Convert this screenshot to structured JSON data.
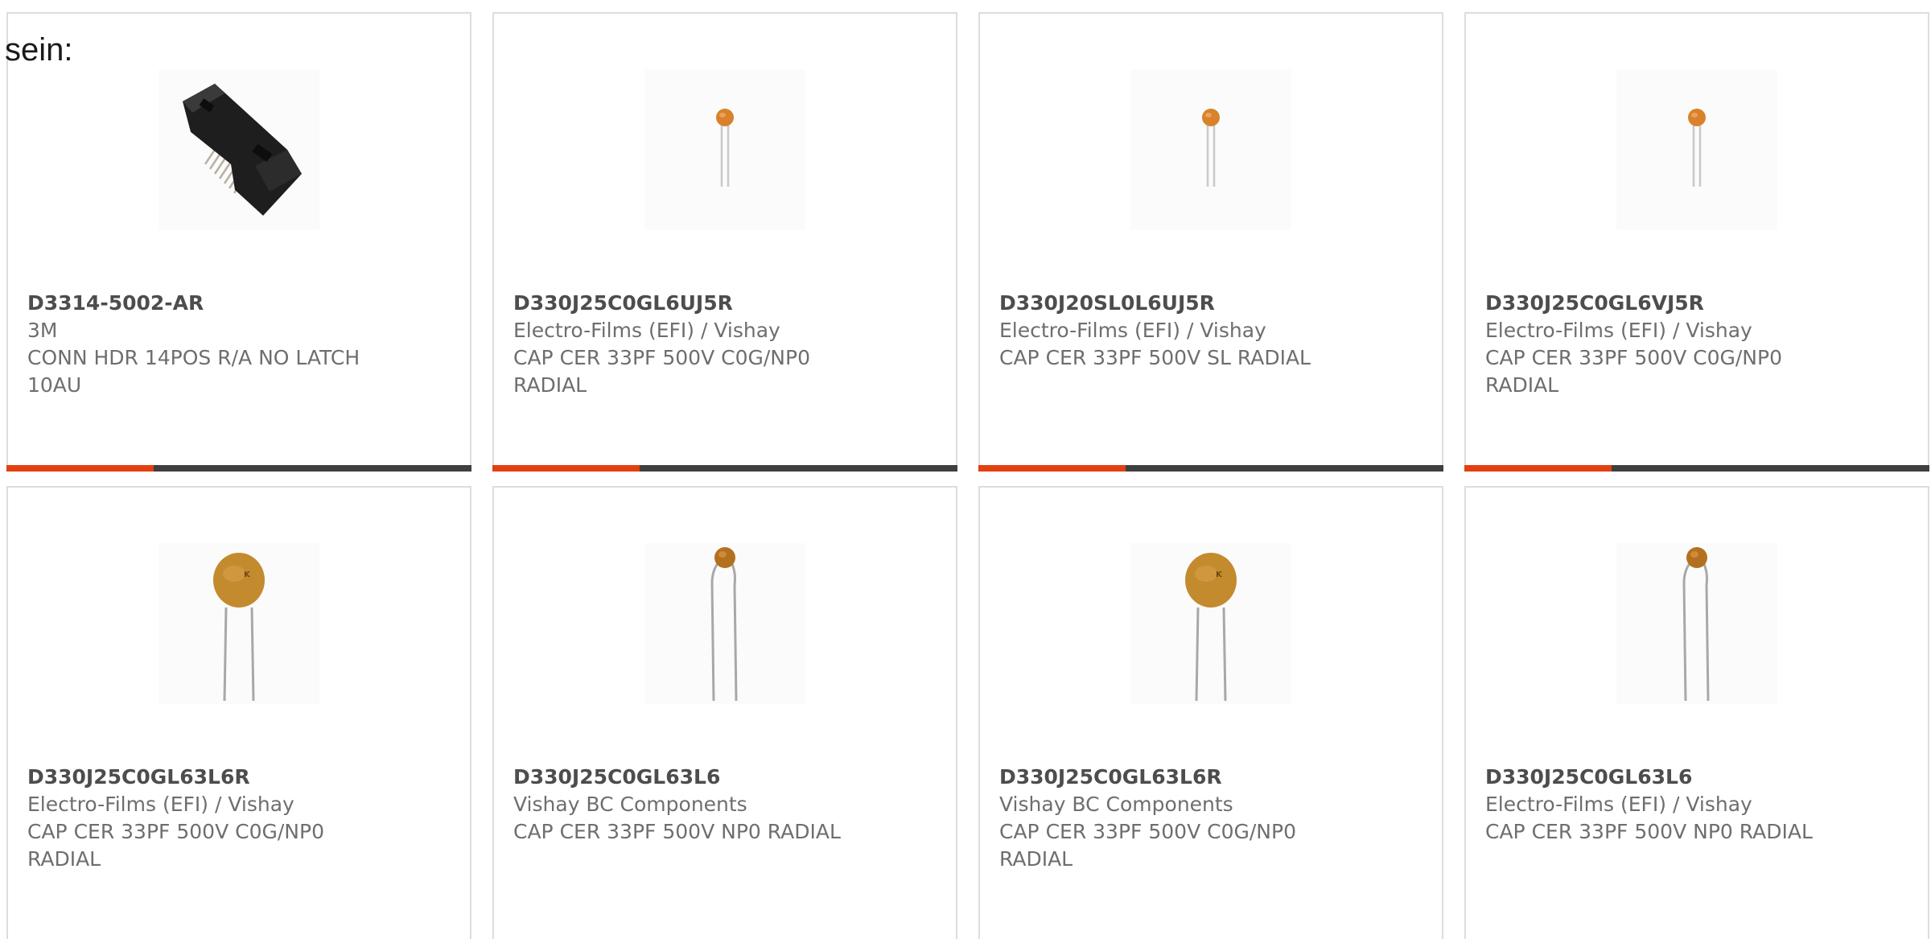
{
  "heading": "sein:",
  "colors": {
    "accent": "#e24011",
    "bar": "#3f3f3f",
    "border": "#dddddd",
    "text": "#6e6e6e"
  },
  "products": [
    {
      "part_number": "D3314-5002-AR",
      "manufacturer": "3M",
      "description": "CONN HDR 14POS R/A NO LATCH 10AU",
      "image": "connector-header-image"
    },
    {
      "part_number": "D330J25C0GL6UJ5R",
      "manufacturer": "Electro-Films (EFI) / Vishay",
      "description": "CAP CER 33PF 500V C0G/NP0 RADIAL",
      "image": "small-ceramic-capacitor-image"
    },
    {
      "part_number": "D330J20SL0L6UJ5R",
      "manufacturer": "Electro-Films (EFI) / Vishay",
      "description": "CAP CER 33PF 500V SL RADIAL",
      "image": "small-ceramic-capacitor-image"
    },
    {
      "part_number": "D330J25C0GL6VJ5R",
      "manufacturer": "Electro-Films (EFI) / Vishay",
      "description": "CAP CER 33PF 500V C0G/NP0 RADIAL",
      "image": "small-ceramic-capacitor-image"
    },
    {
      "part_number": "D330J25C0GL63L6R",
      "manufacturer": "Electro-Films (EFI) / Vishay",
      "description": "CAP CER 33PF 500V C0G/NP0 RADIAL",
      "image": "disc-ceramic-capacitor-image"
    },
    {
      "part_number": "D330J25C0GL63L6",
      "manufacturer": "Vishay BC Components",
      "description": "CAP CER 33PF 500V NP0 RADIAL",
      "image": "bead-ceramic-capacitor-image"
    },
    {
      "part_number": "D330J25C0GL63L6R",
      "manufacturer": "Vishay BC Components",
      "description": "CAP CER 33PF 500V C0G/NP0 RADIAL",
      "image": "disc-ceramic-capacitor-image"
    },
    {
      "part_number": "D330J25C0GL63L6",
      "manufacturer": "Electro-Films (EFI) / Vishay",
      "description": "CAP CER 33PF 500V NP0 RADIAL",
      "image": "bead-ceramic-capacitor-image"
    }
  ]
}
